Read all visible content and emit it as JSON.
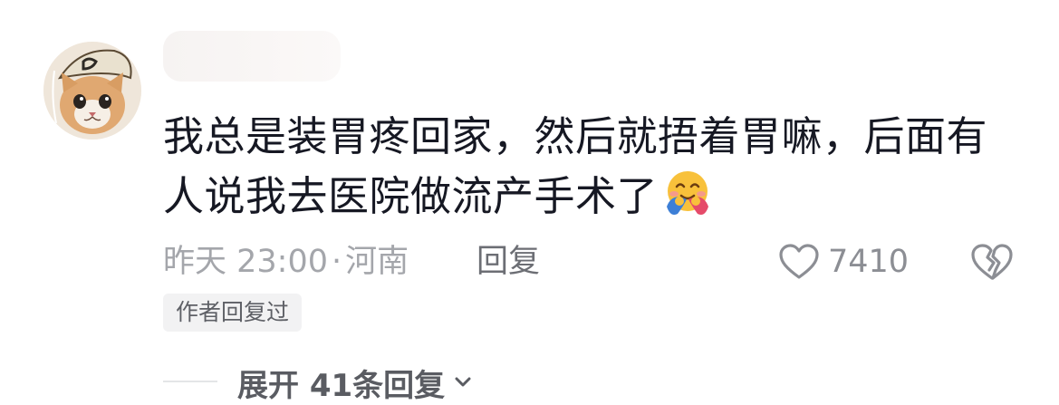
{
  "comment": {
    "username": "",
    "text_lines": [
      "我总是装胃疼回家，然后就捂着胃嘛，后面有",
      "人说我去医院做流产手术了"
    ],
    "emoji": "smiling-face-with-open-hands-emoji",
    "time": "昨天 23:00",
    "dot": "·",
    "location": "河南",
    "reply_label": "回复",
    "like_count": "7410",
    "author_badge": "作者回复过",
    "expand_label": "展开 41条回复"
  },
  "icons": {
    "like": "heart-outline-icon",
    "dislike": "broken-heart-icon",
    "expand": "chevron-down-icon"
  },
  "colors": {
    "text": "#161823",
    "meta": "#a4a6ab",
    "badge_bg": "#f2f2f3"
  }
}
